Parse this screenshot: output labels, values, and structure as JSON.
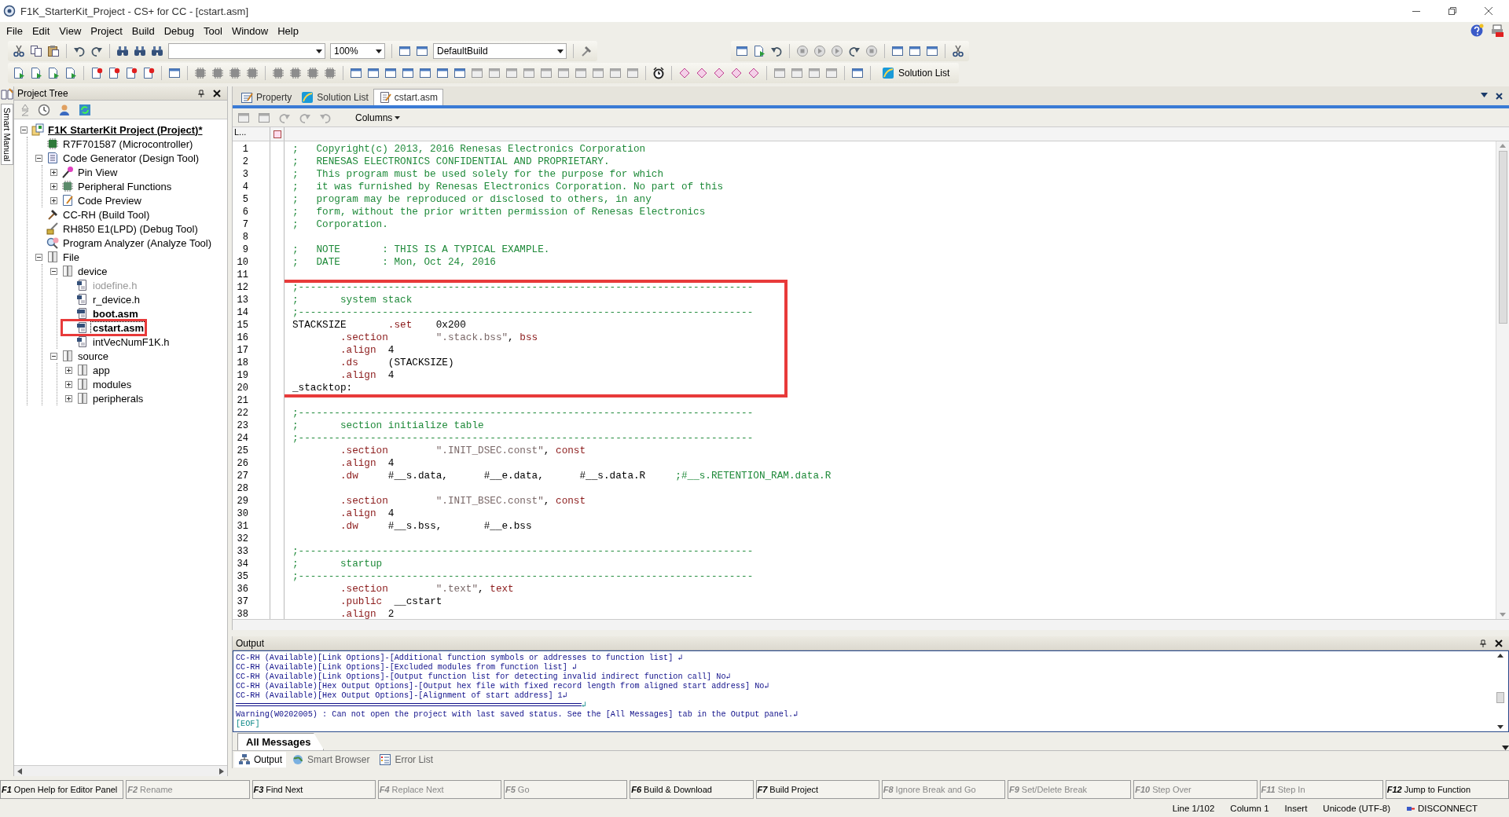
{
  "window": {
    "title": "F1K_StarterKit_Project - CS+ for CC - [cstart.asm]"
  },
  "menu": [
    "File",
    "Edit",
    "View",
    "Project",
    "Build",
    "Debug",
    "Tool",
    "Window",
    "Help"
  ],
  "toolbar": {
    "zoom": "100%",
    "build_mode": "DefaultBuild",
    "solution_button": "Solution List"
  },
  "side_tab": "Smart Manual",
  "project_tree": {
    "title": "Project Tree",
    "nodes": [
      {
        "label": "F1K StarterKit Project (Project)*",
        "kind": "project",
        "expanded": true,
        "selected": false,
        "children": [
          {
            "label": "R7F701587 (Microcontroller)",
            "kind": "micro",
            "selected": false
          },
          {
            "label": "Code Generator (Design Tool)",
            "kind": "codegen",
            "expanded": true,
            "selected": false,
            "children": [
              {
                "label": "Pin View",
                "kind": "pin",
                "expanded": false,
                "selected": false
              },
              {
                "label": "Peripheral Functions",
                "kind": "periph",
                "expanded": false,
                "selected": false
              },
              {
                "label": "Code Preview",
                "kind": "preview",
                "expanded": false,
                "selected": false
              }
            ]
          },
          {
            "label": "CC-RH (Build Tool)",
            "kind": "build",
            "selected": false
          },
          {
            "label": "RH850 E1(LPD) (Debug Tool)",
            "kind": "debug",
            "selected": false
          },
          {
            "label": "Program Analyzer (Analyze Tool)",
            "kind": "analyzer",
            "selected": false
          },
          {
            "label": "File",
            "kind": "folder",
            "expanded": true,
            "selected": false,
            "children": [
              {
                "label": "device",
                "kind": "folder",
                "expanded": true,
                "selected": false,
                "children": [
                  {
                    "label": "iodefine.h",
                    "kind": "header",
                    "selected": false,
                    "disabled": true,
                    "emphasized": false,
                    "highlighted": false
                  },
                  {
                    "label": "r_device.h",
                    "kind": "header",
                    "selected": false,
                    "disabled": false,
                    "emphasized": false,
                    "highlighted": false
                  },
                  {
                    "label": "boot.asm",
                    "kind": "asm",
                    "selected": false,
                    "disabled": false,
                    "emphasized": true,
                    "highlighted": false
                  },
                  {
                    "label": "cstart.asm",
                    "kind": "asm",
                    "selected": true,
                    "disabled": false,
                    "emphasized": true,
                    "highlighted": true
                  },
                  {
                    "label": "intVecNumF1K.h",
                    "kind": "header",
                    "selected": false,
                    "disabled": false,
                    "emphasized": false,
                    "highlighted": false
                  }
                ]
              },
              {
                "label": "source",
                "kind": "folder",
                "expanded": true,
                "selected": false,
                "children": [
                  {
                    "label": "app",
                    "kind": "folder",
                    "expanded": false,
                    "selected": false
                  },
                  {
                    "label": "modules",
                    "kind": "folder",
                    "expanded": false,
                    "selected": false
                  },
                  {
                    "label": "peripherals",
                    "kind": "folder",
                    "expanded": false,
                    "selected": false
                  }
                ]
              }
            ]
          }
        ]
      }
    ]
  },
  "editor": {
    "tabs": [
      {
        "label": "Property",
        "kind": "property",
        "selected": false
      },
      {
        "label": "Solution List",
        "kind": "solution",
        "selected": false
      },
      {
        "label": "cstart.asm",
        "kind": "file",
        "selected": true
      }
    ],
    "columns_button": "Columns",
    "gutter_header": "L...",
    "lines": [
      {
        "number": "1",
        "highlighted": false,
        "segments": [
          {
            "text": ";   Copyright(c) 2013, 2016 Renesas Electronics Corporation",
            "kind": "comment"
          }
        ]
      },
      {
        "number": "2",
        "highlighted": false,
        "segments": [
          {
            "text": ";   RENESAS ELECTRONICS CONFIDENTIAL AND PROPRIETARY.",
            "kind": "comment"
          }
        ]
      },
      {
        "number": "3",
        "highlighted": false,
        "segments": [
          {
            "text": ";   This program must be used solely for the purpose for which",
            "kind": "comment"
          }
        ]
      },
      {
        "number": "4",
        "highlighted": false,
        "segments": [
          {
            "text": ";   it was furnished by Renesas Electronics Corporation. No part of this",
            "kind": "comment"
          }
        ]
      },
      {
        "number": "5",
        "highlighted": false,
        "segments": [
          {
            "text": ";   program may be reproduced or disclosed to others, in any",
            "kind": "comment"
          }
        ]
      },
      {
        "number": "6",
        "highlighted": false,
        "segments": [
          {
            "text": ";   form, without the prior written permission of Renesas Electronics",
            "kind": "comment"
          }
        ]
      },
      {
        "number": "7",
        "highlighted": false,
        "segments": [
          {
            "text": ";   Corporation.",
            "kind": "comment"
          }
        ]
      },
      {
        "number": "8",
        "highlighted": false
      },
      {
        "number": "9",
        "highlighted": false,
        "segments": [
          {
            "text": ";   NOTE       : THIS IS A TYPICAL EXAMPLE.",
            "kind": "comment"
          }
        ]
      },
      {
        "number": "10",
        "highlighted": false,
        "segments": [
          {
            "text": ";   DATE       : Mon, Oct 24, 2016",
            "kind": "comment"
          }
        ]
      },
      {
        "number": "11",
        "highlighted": false
      },
      {
        "number": "12",
        "highlighted": true,
        "segments": [
          {
            "text": ";----------------------------------------------------------------------------",
            "kind": "comment"
          }
        ]
      },
      {
        "number": "13",
        "highlighted": true,
        "segments": [
          {
            "text": ";       system stack",
            "kind": "comment"
          }
        ]
      },
      {
        "number": "14",
        "highlighted": true,
        "segments": [
          {
            "text": ";----------------------------------------------------------------------------",
            "kind": "comment"
          }
        ]
      },
      {
        "number": "15",
        "highlighted": true,
        "segments": [
          {
            "text": "STACKSIZE       ",
            "kind": "plain"
          },
          {
            "text": ".set",
            "kind": "directive"
          },
          {
            "text": "    0x200",
            "kind": "plain"
          }
        ]
      },
      {
        "number": "16",
        "highlighted": true,
        "segments": [
          {
            "text": "        .section",
            "kind": "directive"
          },
          {
            "text": "        \".stack.bss\"",
            "kind": "string"
          },
          {
            "text": ", ",
            "kind": "plain"
          },
          {
            "text": "bss",
            "kind": "directive"
          }
        ]
      },
      {
        "number": "17",
        "highlighted": true,
        "segments": [
          {
            "text": "        .align",
            "kind": "directive"
          },
          {
            "text": "  4",
            "kind": "plain"
          }
        ]
      },
      {
        "number": "18",
        "highlighted": true,
        "segments": [
          {
            "text": "        .ds",
            "kind": "directive"
          },
          {
            "text": "     (STACKSIZE)",
            "kind": "plain"
          }
        ]
      },
      {
        "number": "19",
        "highlighted": true,
        "segments": [
          {
            "text": "        .align",
            "kind": "directive"
          },
          {
            "text": "  4",
            "kind": "plain"
          }
        ]
      },
      {
        "number": "20",
        "highlighted": true,
        "segments": [
          {
            "text": "_stacktop:",
            "kind": "plain"
          }
        ]
      },
      {
        "number": "21",
        "highlighted": false
      },
      {
        "number": "22",
        "highlighted": false,
        "segments": [
          {
            "text": ";----------------------------------------------------------------------------",
            "kind": "comment"
          }
        ]
      },
      {
        "number": "23",
        "highlighted": false,
        "segments": [
          {
            "text": ";       section initialize table",
            "kind": "comment"
          }
        ]
      },
      {
        "number": "24",
        "highlighted": false,
        "segments": [
          {
            "text": ";----------------------------------------------------------------------------",
            "kind": "comment"
          }
        ]
      },
      {
        "number": "25",
        "highlighted": false,
        "segments": [
          {
            "text": "        .section",
            "kind": "directive"
          },
          {
            "text": "        \".INIT_DSEC.const\"",
            "kind": "string"
          },
          {
            "text": ", ",
            "kind": "plain"
          },
          {
            "text": "const",
            "kind": "directive"
          }
        ]
      },
      {
        "number": "26",
        "highlighted": false,
        "segments": [
          {
            "text": "        .align",
            "kind": "directive"
          },
          {
            "text": "  4",
            "kind": "plain"
          }
        ]
      },
      {
        "number": "27",
        "highlighted": false,
        "segments": [
          {
            "text": "        .dw",
            "kind": "directive"
          },
          {
            "text": "     #__s.data,      #__e.data,      #__s.data.R     ",
            "kind": "plain"
          },
          {
            "text": ";#__s.RETENTION_RAM.data.R",
            "kind": "comment"
          }
        ]
      },
      {
        "number": "28",
        "highlighted": false
      },
      {
        "number": "29",
        "highlighted": false,
        "segments": [
          {
            "text": "        .section",
            "kind": "directive"
          },
          {
            "text": "        \".INIT_BSEC.const\"",
            "kind": "string"
          },
          {
            "text": ", ",
            "kind": "plain"
          },
          {
            "text": "const",
            "kind": "directive"
          }
        ]
      },
      {
        "number": "30",
        "highlighted": false,
        "segments": [
          {
            "text": "        .align",
            "kind": "directive"
          },
          {
            "text": "  4",
            "kind": "plain"
          }
        ]
      },
      {
        "number": "31",
        "highlighted": false,
        "segments": [
          {
            "text": "        .dw",
            "kind": "directive"
          },
          {
            "text": "     #__s.bss,       #__e.bss",
            "kind": "plain"
          }
        ]
      },
      {
        "number": "32",
        "highlighted": false
      },
      {
        "number": "33",
        "highlighted": false,
        "segments": [
          {
            "text": ";----------------------------------------------------------------------------",
            "kind": "comment"
          }
        ]
      },
      {
        "number": "34",
        "highlighted": false,
        "segments": [
          {
            "text": ";       startup",
            "kind": "comment"
          }
        ]
      },
      {
        "number": "35",
        "highlighted": false,
        "segments": [
          {
            "text": ";----------------------------------------------------------------------------",
            "kind": "comment"
          }
        ]
      },
      {
        "number": "36",
        "highlighted": false,
        "segments": [
          {
            "text": "        .section",
            "kind": "directive"
          },
          {
            "text": "        \".text\"",
            "kind": "string"
          },
          {
            "text": ", ",
            "kind": "plain"
          },
          {
            "text": "text",
            "kind": "directive"
          }
        ]
      },
      {
        "number": "37",
        "highlighted": false,
        "segments": [
          {
            "text": "        .public",
            "kind": "directive"
          },
          {
            "text": "  __cstart",
            "kind": "plain"
          }
        ]
      },
      {
        "number": "38",
        "highlighted": false,
        "segments": [
          {
            "text": "        .align",
            "kind": "directive"
          },
          {
            "text": "  2",
            "kind": "plain"
          }
        ]
      }
    ]
  },
  "output": {
    "title": "Output",
    "lines": [
      {
        "text": "CC-RH (Available)[Link Options]-[Additional function symbols or addresses to function list] ↲",
        "kind": "message"
      },
      {
        "text": "CC-RH (Available)[Link Options]-[Excluded modules from function list] ↲",
        "kind": "message"
      },
      {
        "text": "CC-RH (Available)[Link Options]-[Output function list for detecting invalid indirect function call] No↲",
        "kind": "message"
      },
      {
        "text": "CC-RH (Available)[Hex Output Options]-[Output hex file with fixed record length from aligned start address] No↲",
        "kind": "message"
      },
      {
        "text": "CC-RH (Available)[Hex Output Options]-[Alignment of start address] 1↲",
        "kind": "message"
      },
      {
        "text": "↲",
        "kind": "rule"
      },
      {
        "text": "Warning(W0202005) : Can not open the project with last saved status. See the [All Messages] tab in the Output panel.↲",
        "kind": "message"
      },
      {
        "text": "[EOF]",
        "kind": "eof"
      }
    ],
    "filter_tabs": [
      {
        "label": "All Messages",
        "selected": true
      }
    ],
    "panel_tabs": [
      {
        "label": "Output",
        "kind": "output",
        "selected": true
      },
      {
        "label": "Smart Browser",
        "kind": "browser",
        "selected": false
      },
      {
        "label": "Error List",
        "kind": "errors",
        "selected": false
      }
    ]
  },
  "function_keys": [
    {
      "key": "F1",
      "label": "Open Help for Editor Panel",
      "disabled": false
    },
    {
      "key": "F2",
      "label": "Rename",
      "disabled": true
    },
    {
      "key": "F3",
      "label": "Find Next",
      "disabled": false
    },
    {
      "key": "F4",
      "label": "Replace Next",
      "disabled": true
    },
    {
      "key": "F5",
      "label": "Go",
      "disabled": true
    },
    {
      "key": "F6",
      "label": "Build & Download",
      "disabled": false
    },
    {
      "key": "F7",
      "label": "Build Project",
      "disabled": false
    },
    {
      "key": "F8",
      "label": "Ignore Break and Go",
      "disabled": true
    },
    {
      "key": "F9",
      "label": "Set/Delete Break",
      "disabled": true
    },
    {
      "key": "F10",
      "label": "Step Over",
      "disabled": true
    },
    {
      "key": "F11",
      "label": "Step In",
      "disabled": true
    },
    {
      "key": "F12",
      "label": "Jump to Function",
      "disabled": false
    }
  ],
  "status_bar": [
    "Line 1/102",
    "Column 1",
    "Insert",
    "Unicode (UTF-8)",
    "DISCONNECT"
  ]
}
